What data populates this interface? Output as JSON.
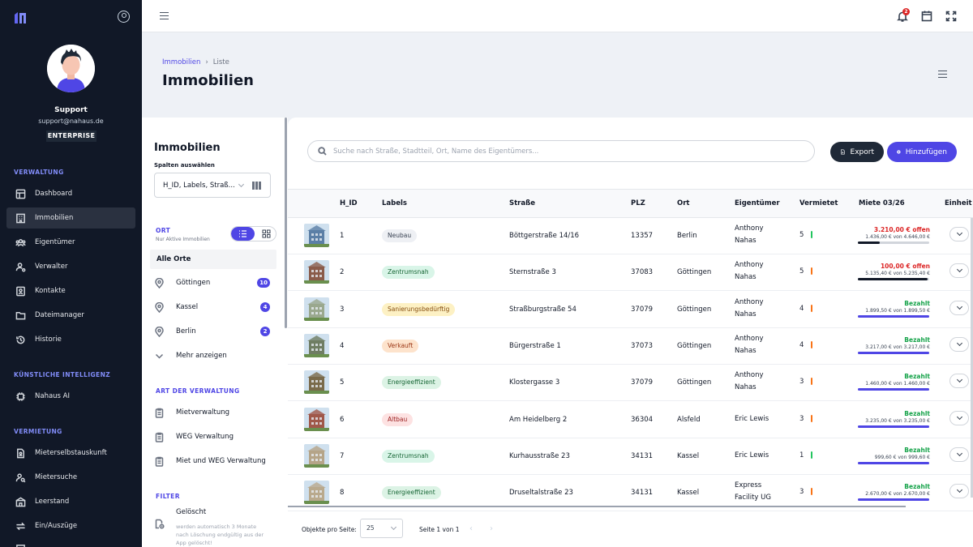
{
  "sidebar": {
    "user": {
      "name": "Support",
      "email": "support@nahaus.de",
      "plan": "ENTERPRISE"
    },
    "sections": [
      {
        "title": "VERWALTUNG"
      },
      {
        "title": "KÜNSTLICHE INTELLIGENZ"
      },
      {
        "title": "VERMIETUNG"
      }
    ],
    "items": [
      {
        "label": "Dashboard",
        "icon": "dashboard-icon"
      },
      {
        "label": "Immobilien",
        "icon": "building-icon",
        "active": true
      },
      {
        "label": "Eigentümer",
        "icon": "users-icon"
      },
      {
        "label": "Verwalter",
        "icon": "user-gear-icon"
      },
      {
        "label": "Kontakte",
        "icon": "contact-icon"
      },
      {
        "label": "Dateimanager",
        "icon": "folder-icon"
      },
      {
        "label": "Historie",
        "icon": "history-icon"
      },
      {
        "label": "Nahaus AI",
        "icon": "chip-icon"
      },
      {
        "label": "Mieterselbstauskunft",
        "icon": "document-user-icon"
      },
      {
        "label": "Mietersuche",
        "icon": "user-search-icon"
      },
      {
        "label": "Leerstand",
        "icon": "vacancy-icon"
      },
      {
        "label": "Ein/Auszüge",
        "icon": "move-icon"
      }
    ]
  },
  "topbar": {
    "notifications_count": "2"
  },
  "header": {
    "breadcrumb_root": "Immobilien",
    "breadcrumb_current": "Liste",
    "title": "Immobilien"
  },
  "filter": {
    "title": "Immobilien",
    "columns_label": "Spalten auswählen",
    "columns_value": "H_ID, Labels, Straß...",
    "location_section": "ORT",
    "location_note": "Nur Aktive Immobilien",
    "all_locations": "Alle Orte",
    "locations": [
      {
        "name": "Göttingen",
        "count": "10"
      },
      {
        "name": "Kassel",
        "count": "4"
      },
      {
        "name": "Berlin",
        "count": "2"
      }
    ],
    "show_more": "Mehr anzeigen",
    "management_section": "ART DER VERWALTUNG",
    "management_types": [
      "Mietverwaltung",
      "WEG Verwaltung",
      "Miet und WEG Verwaltung"
    ],
    "filter_section": "FILTER",
    "deleted_title": "Gelöscht",
    "deleted_desc": "werden automatisch 3 Monate nach Löschung endgültig aus der App gelöscht!"
  },
  "table": {
    "search_placeholder": "Suche nach Straße, Stadtteil, Ort, Name des Eigentümers...",
    "export_label": "Export",
    "add_label": "Hinzufügen",
    "columns": [
      "H_ID",
      "Labels",
      "Straße",
      "PLZ",
      "Ort",
      "Eigentümer",
      "Vermietet",
      "Miete 03/26",
      "Einheit"
    ],
    "rows": [
      {
        "id": "1",
        "label": "Neubau",
        "label_bg": "#eef0f4",
        "label_fg": "#374151",
        "street": "Böttgerstraße 14/16",
        "plz": "13357",
        "city": "Berlin",
        "owner1": "Anthony",
        "owner2": "Nahas",
        "rented": "5",
        "rent_color": "#22c55e",
        "status": "3.210,00 € offen",
        "status_color": "#dc2626",
        "detail": "1.436,00 € von 4.646,00 €",
        "fill": 0.31,
        "fill_color": "#111827",
        "thumb": "#5b7fa6"
      },
      {
        "id": "2",
        "label": "Zentrumsnah",
        "label_bg": "#d9f5e8",
        "label_fg": "#166534",
        "street": "Sternstraße 3",
        "plz": "37083",
        "city": "Göttingen",
        "owner1": "Anthony",
        "owner2": "Nahas",
        "rented": "5",
        "rent_color": "#f97316",
        "status": "100,00 € offen",
        "status_color": "#dc2626",
        "detail": "5.135,40 € von 5.235,40 €",
        "fill": 0.98,
        "fill_color": "#111827",
        "thumb": "#8a5b4a"
      },
      {
        "id": "3",
        "label": "Sanierungsbedürftig",
        "label_bg": "#fdf1c4",
        "label_fg": "#854d0e",
        "street": "Straßburgstraße 54",
        "plz": "37079",
        "city": "Göttingen",
        "owner1": "Anthony",
        "owner2": "Nahas",
        "rented": "4",
        "rent_color": "#f97316",
        "status": "Bezahlt",
        "status_color": "#16a34a",
        "detail": "1.899,50 € von 1.899,50 €",
        "fill": 1,
        "fill_color": "#4f46e5",
        "thumb": "#9aa88e"
      },
      {
        "id": "4",
        "label": "Verkauft",
        "label_bg": "#fde3cc",
        "label_fg": "#9a3412",
        "street": "Bürgerstraße 1",
        "plz": "37073",
        "city": "Göttingen",
        "owner1": "Anthony",
        "owner2": "Nahas",
        "rented": "4",
        "rent_color": "#f97316",
        "status": "Bezahlt",
        "status_color": "#16a34a",
        "detail": "3.217,00 € von 3.217,00 €",
        "fill": 1,
        "fill_color": "#4f46e5",
        "thumb": "#6f7d63"
      },
      {
        "id": "5",
        "label": "Energieeffizient",
        "label_bg": "#dcf3e5",
        "label_fg": "#166534",
        "street": "Klostergasse 3",
        "plz": "37079",
        "city": "Göttingen",
        "owner1": "Anthony",
        "owner2": "Nahas",
        "rented": "3",
        "rent_color": "#f97316",
        "status": "Bezahlt",
        "status_color": "#16a34a",
        "detail": "1.460,00 € von 1.460,00 €",
        "fill": 1,
        "fill_color": "#4f46e5",
        "thumb": "#7a6a4a"
      },
      {
        "id": "6",
        "label": "Altbau",
        "label_bg": "#fde2e2",
        "label_fg": "#991b1b",
        "street": "Am Heidelberg 2",
        "plz": "36304",
        "city": "Alsfeld",
        "owner1": "Eric Lewis",
        "owner2": "",
        "rented": "3",
        "rent_color": "#f97316",
        "status": "Bezahlt",
        "status_color": "#16a34a",
        "detail": "3.235,00 € von 3.235,00 €",
        "fill": 1,
        "fill_color": "#4f46e5",
        "thumb": "#a0584a"
      },
      {
        "id": "7",
        "label": "Zentrumsnah",
        "label_bg": "#d9f5e8",
        "label_fg": "#166534",
        "street": "Kurhausstraße 23",
        "plz": "34131",
        "city": "Kassel",
        "owner1": "Eric Lewis",
        "owner2": "",
        "rented": "1",
        "rent_color": "#22c55e",
        "status": "Bezahlt",
        "status_color": "#16a34a",
        "detail": "999,60 € von 999,60 €",
        "fill": 1,
        "fill_color": "#4f46e5",
        "thumb": "#b5a488"
      },
      {
        "id": "8",
        "label": "Energieeffizient",
        "label_bg": "#dcf3e5",
        "label_fg": "#166534",
        "street": "Druseltalstraße 23",
        "plz": "34131",
        "city": "Kassel",
        "owner1": "Express",
        "owner2": "Facility UG",
        "rented": "3",
        "rent_color": "#f97316",
        "status": "Bezahlt",
        "status_color": "#16a34a",
        "detail": "2.670,00 € von 2.670,00 €",
        "fill": 1,
        "fill_color": "#4f46e5",
        "thumb": "#b9a98d"
      }
    ],
    "per_page_label": "Objekte pro Seite:",
    "per_page_value": "25",
    "page_info": "Seite 1 von 1"
  },
  "colors": {
    "accent": "#4f46e5",
    "sidebar_bg": "#111827",
    "danger": "#dc2626",
    "success": "#16a34a"
  }
}
